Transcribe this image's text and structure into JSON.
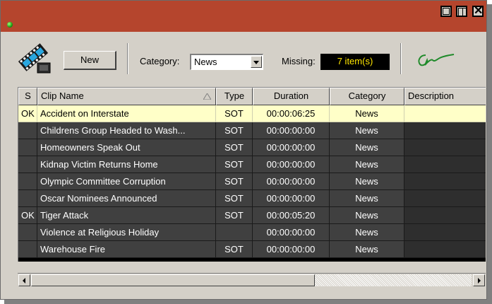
{
  "window": {
    "accent_color": "#b5452d",
    "controls": [
      "minimize-icon",
      "maximize-icon",
      "close-icon"
    ],
    "close_glyph": "✕"
  },
  "toolbar": {
    "new_label": "New",
    "category_label": "Category:",
    "category_value": "News",
    "missing_label": "Missing:",
    "missing_value": "7 item(s)"
  },
  "table": {
    "columns": [
      "S",
      "Clip Name",
      "Type",
      "Duration",
      "Category",
      "Description"
    ],
    "rows": [
      {
        "s": "OK",
        "name": "Accident on Interstate",
        "type": "SOT",
        "duration": "00:00:06:25",
        "category": "News",
        "description": ""
      },
      {
        "s": "",
        "name": "Childrens Group Headed to Wash...",
        "type": "SOT",
        "duration": "00:00:00:00",
        "category": "News",
        "description": ""
      },
      {
        "s": "",
        "name": "Homeowners Speak Out",
        "type": "SOT",
        "duration": "00:00:00:00",
        "category": "News",
        "description": ""
      },
      {
        "s": "",
        "name": "Kidnap Victim Returns Home",
        "type": "SOT",
        "duration": "00:00:00:00",
        "category": "News",
        "description": ""
      },
      {
        "s": "",
        "name": "Olympic Committee Corruption",
        "type": "SOT",
        "duration": "00:00:00:00",
        "category": "News",
        "description": ""
      },
      {
        "s": "",
        "name": "Oscar Nominees Announced",
        "type": "SOT",
        "duration": "00:00:00:00",
        "category": "News",
        "description": ""
      },
      {
        "s": "OK",
        "name": "Tiger Attack",
        "type": "SOT",
        "duration": "00:00:05:20",
        "category": "News",
        "description": ""
      },
      {
        "s": "",
        "name": "Violence at Religious Holiday",
        "type": "",
        "duration": "00:00:00:00",
        "category": "News",
        "description": ""
      },
      {
        "s": "",
        "name": "Warehouse Fire",
        "type": "SOT",
        "duration": "00:00:00:00",
        "category": "News",
        "description": ""
      }
    ]
  },
  "colors": {
    "row_dark": "#404040",
    "row_selected": "#ffffc8",
    "missing_text": "#ffe600"
  }
}
